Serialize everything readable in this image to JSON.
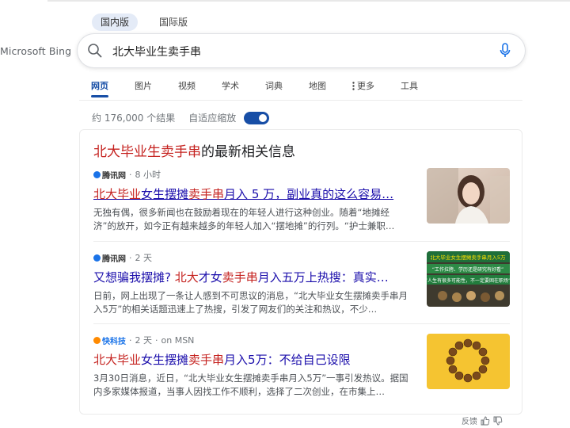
{
  "region_tabs": [
    "国内版",
    "国际版"
  ],
  "logo": "Microsoft Bing",
  "search": {
    "query": "北大毕业生卖手串"
  },
  "nav": [
    "网页",
    "图片",
    "视频",
    "学术",
    "词典",
    "地图",
    "更多",
    "工具"
  ],
  "results_meta": {
    "count": "约 176,000 个结果",
    "adaptive": "自适应缩放",
    "adaptive_on": true
  },
  "card": {
    "title_highlight": "北大毕业生卖手串",
    "title_rest": "的最新相关信息",
    "items": [
      {
        "source_logo": "腾讯网",
        "age": "8 小时",
        "headline_hl1": "北大毕业",
        "headline_mid1": "女生摆摊",
        "headline_hl2": "卖手串",
        "headline_rest": "月入 5 万，副业真的这么容易…",
        "snippet": "无独有偶，很多新闻也在鼓励着现在的年轻人进行这种创业。随着“地摊经济”的放开，如今正有越来越多的年轻人加入“摆地摊”的行列。“护士兼职…"
      },
      {
        "source_logo": "腾讯网",
        "age": "2 天",
        "headline_pre": "又想骗我摆摊? ",
        "headline_hl1": "北大",
        "headline_mid1": "才女",
        "headline_hl2": "卖手串",
        "headline_rest": "月入五万上热搜：真实…",
        "snippet": "日前，网上出现了一条让人感到不可思议的消息，“北大毕业女生摆摊卖手串月入5万”的相关话题迅速上了热搜，引发了网友们的关注和热议，不少…",
        "thumb_text_1": "北大毕业女生摆摊卖手串月入5万",
        "thumb_text_2": "“工作拉胯、学历还是研究有好看”",
        "thumb_text_3": "“人生有很多可能性，不一定要困在职场”"
      },
      {
        "source_logo": "快科技",
        "age": "2 天",
        "via": "on MSN",
        "headline_hl1": "北大毕业",
        "headline_mid1": "女生摆摊",
        "headline_hl2": "卖手串",
        "headline_rest": "月入5万：不给自己设限",
        "snippet": "3月30日消息，近日，“北大毕业女生摆摊卖手串月入5万”一事引发热议。据国内多家媒体报道，当事人因找工作不顺利，选择了二次创业，在市集上…"
      }
    ]
  },
  "feedback": "反馈",
  "colors": {
    "accent": "#174ea6",
    "link": "#1a0dab",
    "highlight": "#c5221f"
  }
}
